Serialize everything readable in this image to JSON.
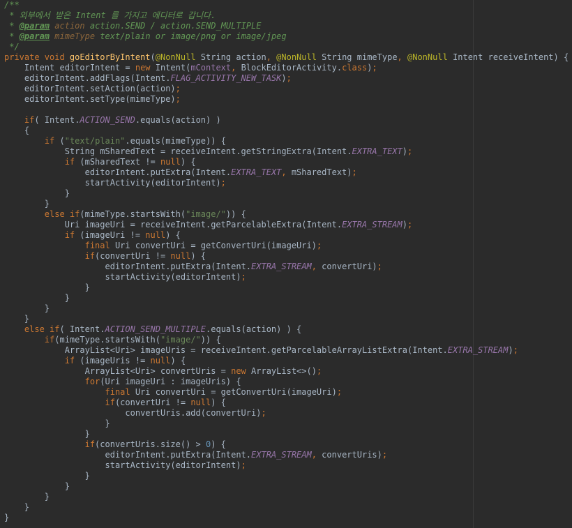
{
  "colors": {
    "background": "#2b2b2b",
    "text": "#a9b7c6",
    "keyword": "#cc7832",
    "string": "#6a8759",
    "number": "#6897bb",
    "annotation": "#bbb529",
    "method_declaration": "#ffc66d",
    "field": "#9876aa",
    "doc_comment": "#629755"
  },
  "lines": [
    [
      {
        "c": "cmt",
        "t": "/**"
      }
    ],
    [
      {
        "c": "cmt",
        "t": " * 외부에서 받은 Intent 를 가지고 에디터로 갑니다."
      }
    ],
    [
      {
        "c": "cmt",
        "t": " * "
      },
      {
        "c": "tag",
        "t": "@param"
      },
      {
        "c": "cmt",
        "t": " "
      },
      {
        "c": "tagv",
        "t": "action"
      },
      {
        "c": "cmt",
        "t": " action.SEND / action.SEND_MULTIPLE"
      }
    ],
    [
      {
        "c": "cmt",
        "t": " * "
      },
      {
        "c": "tag",
        "t": "@param"
      },
      {
        "c": "cmt",
        "t": " "
      },
      {
        "c": "tagv",
        "t": "mimeType"
      },
      {
        "c": "cmt",
        "t": " text/plain or image/png or image/jpeg"
      }
    ],
    [
      {
        "c": "cmt",
        "t": " */"
      }
    ],
    [
      {
        "c": "kw",
        "t": "private void "
      },
      {
        "c": "fn",
        "t": "goEditorByIntent"
      },
      {
        "c": "pl",
        "t": "("
      },
      {
        "c": "ann",
        "t": "@NonNull"
      },
      {
        "c": "pl",
        "t": " String action"
      },
      {
        "c": "kw",
        "t": ", "
      },
      {
        "c": "ann",
        "t": "@NonNull"
      },
      {
        "c": "pl",
        "t": " String mimeType"
      },
      {
        "c": "kw",
        "t": ", "
      },
      {
        "c": "ann",
        "t": "@NonNull"
      },
      {
        "c": "pl",
        "t": " Intent receiveIntent) {"
      }
    ],
    [
      {
        "c": "pl",
        "t": "    Intent editorIntent = "
      },
      {
        "c": "kw",
        "t": "new "
      },
      {
        "c": "pl",
        "t": "Intent("
      },
      {
        "c": "fld",
        "t": "mContext"
      },
      {
        "c": "kw",
        "t": ", "
      },
      {
        "c": "pl",
        "t": "BlockEditorActivity."
      },
      {
        "c": "kw",
        "t": "class"
      },
      {
        "c": "pl",
        "t": ")"
      },
      {
        "c": "kw",
        "t": ";"
      }
    ],
    [
      {
        "c": "pl",
        "t": "    editorIntent.addFlags(Intent."
      },
      {
        "c": "sfld",
        "t": "FLAG_ACTIVITY_NEW_TASK"
      },
      {
        "c": "pl",
        "t": ")"
      },
      {
        "c": "kw",
        "t": ";"
      }
    ],
    [
      {
        "c": "pl",
        "t": "    editorIntent.setAction(action)"
      },
      {
        "c": "kw",
        "t": ";"
      }
    ],
    [
      {
        "c": "pl",
        "t": "    editorIntent.setType(mimeType)"
      },
      {
        "c": "kw",
        "t": ";"
      }
    ],
    [
      {
        "c": "pl",
        "t": ""
      }
    ],
    [
      {
        "c": "kw",
        "t": "    if"
      },
      {
        "c": "pl",
        "t": "( Intent."
      },
      {
        "c": "sfld",
        "t": "ACTION_SEND"
      },
      {
        "c": "pl",
        "t": ".equals(action) )"
      }
    ],
    [
      {
        "c": "pl",
        "t": "    {"
      }
    ],
    [
      {
        "c": "kw",
        "t": "        if "
      },
      {
        "c": "pl",
        "t": "("
      },
      {
        "c": "str",
        "t": "\"text/plain\""
      },
      {
        "c": "pl",
        "t": ".equals(mimeType)) {"
      }
    ],
    [
      {
        "c": "pl",
        "t": "            String mSharedText = receiveIntent.getStringExtra(Intent."
      },
      {
        "c": "sfld",
        "t": "EXTRA_TEXT"
      },
      {
        "c": "pl",
        "t": ")"
      },
      {
        "c": "kw",
        "t": ";"
      }
    ],
    [
      {
        "c": "kw",
        "t": "            if "
      },
      {
        "c": "pl",
        "t": "(mSharedText != "
      },
      {
        "c": "kw",
        "t": "null"
      },
      {
        "c": "pl",
        "t": ") {"
      }
    ],
    [
      {
        "c": "pl",
        "t": "                editorIntent.putExtra(Intent."
      },
      {
        "c": "sfld",
        "t": "EXTRA_TEXT"
      },
      {
        "c": "kw",
        "t": ", "
      },
      {
        "c": "pl",
        "t": "mSharedText)"
      },
      {
        "c": "kw",
        "t": ";"
      }
    ],
    [
      {
        "c": "pl",
        "t": "                startActivity(editorIntent)"
      },
      {
        "c": "kw",
        "t": ";"
      }
    ],
    [
      {
        "c": "pl",
        "t": "            }"
      }
    ],
    [
      {
        "c": "pl",
        "t": "        }"
      }
    ],
    [
      {
        "c": "kw",
        "t": "        else if"
      },
      {
        "c": "pl",
        "t": "(mimeType.startsWith("
      },
      {
        "c": "str",
        "t": "\"image/\""
      },
      {
        "c": "pl",
        "t": ")) {"
      }
    ],
    [
      {
        "c": "pl",
        "t": "            Uri imageUri = receiveIntent.getParcelableExtra(Intent."
      },
      {
        "c": "sfld",
        "t": "EXTRA_STREAM"
      },
      {
        "c": "pl",
        "t": ")"
      },
      {
        "c": "kw",
        "t": ";"
      }
    ],
    [
      {
        "c": "kw",
        "t": "            if "
      },
      {
        "c": "pl",
        "t": "(imageUri != "
      },
      {
        "c": "kw",
        "t": "null"
      },
      {
        "c": "pl",
        "t": ") {"
      }
    ],
    [
      {
        "c": "kw",
        "t": "                final "
      },
      {
        "c": "pl",
        "t": "Uri convertUri = getConvertUri(imageUri)"
      },
      {
        "c": "kw",
        "t": ";"
      }
    ],
    [
      {
        "c": "kw",
        "t": "                if"
      },
      {
        "c": "pl",
        "t": "(convertUri != "
      },
      {
        "c": "kw",
        "t": "null"
      },
      {
        "c": "pl",
        "t": ") {"
      }
    ],
    [
      {
        "c": "pl",
        "t": "                    editorIntent.putExtra(Intent."
      },
      {
        "c": "sfld",
        "t": "EXTRA_STREAM"
      },
      {
        "c": "kw",
        "t": ", "
      },
      {
        "c": "pl",
        "t": "convertUri)"
      },
      {
        "c": "kw",
        "t": ";"
      }
    ],
    [
      {
        "c": "pl",
        "t": "                    startActivity(editorIntent)"
      },
      {
        "c": "kw",
        "t": ";"
      }
    ],
    [
      {
        "c": "pl",
        "t": "                }"
      }
    ],
    [
      {
        "c": "pl",
        "t": "            }"
      }
    ],
    [
      {
        "c": "pl",
        "t": "        }"
      }
    ],
    [
      {
        "c": "pl",
        "t": "    }"
      }
    ],
    [
      {
        "c": "kw",
        "t": "    else if"
      },
      {
        "c": "pl",
        "t": "( Intent."
      },
      {
        "c": "sfld",
        "t": "ACTION_SEND_MULTIPLE"
      },
      {
        "c": "pl",
        "t": ".equals(action) ) {"
      }
    ],
    [
      {
        "c": "kw",
        "t": "        if"
      },
      {
        "c": "pl",
        "t": "(mimeType.startsWith("
      },
      {
        "c": "str",
        "t": "\"image/\""
      },
      {
        "c": "pl",
        "t": ")) {"
      }
    ],
    [
      {
        "c": "pl",
        "t": "            ArrayList<Uri> imageUris = receiveIntent.getParcelableArrayListExtra(Intent."
      },
      {
        "c": "sfld",
        "t": "EXTRA_STREAM"
      },
      {
        "c": "pl",
        "t": ")"
      },
      {
        "c": "kw",
        "t": ";"
      }
    ],
    [
      {
        "c": "kw",
        "t": "            if "
      },
      {
        "c": "pl",
        "t": "(imageUris != "
      },
      {
        "c": "kw",
        "t": "null"
      },
      {
        "c": "pl",
        "t": ") {"
      }
    ],
    [
      {
        "c": "pl",
        "t": "                ArrayList<Uri> convertUris = "
      },
      {
        "c": "kw",
        "t": "new "
      },
      {
        "c": "pl",
        "t": "ArrayList<>()"
      },
      {
        "c": "kw",
        "t": ";"
      }
    ],
    [
      {
        "c": "kw",
        "t": "                for"
      },
      {
        "c": "pl",
        "t": "(Uri imageUri : imageUris) {"
      }
    ],
    [
      {
        "c": "kw",
        "t": "                    final "
      },
      {
        "c": "pl",
        "t": "Uri convertUri = getConvertUri(imageUri)"
      },
      {
        "c": "kw",
        "t": ";"
      }
    ],
    [
      {
        "c": "kw",
        "t": "                    if"
      },
      {
        "c": "pl",
        "t": "(convertUri != "
      },
      {
        "c": "kw",
        "t": "null"
      },
      {
        "c": "pl",
        "t": ") {"
      }
    ],
    [
      {
        "c": "pl",
        "t": "                        convertUris.add(convertUri)"
      },
      {
        "c": "kw",
        "t": ";"
      }
    ],
    [
      {
        "c": "pl",
        "t": "                    }"
      }
    ],
    [
      {
        "c": "pl",
        "t": "                }"
      }
    ],
    [
      {
        "c": "kw",
        "t": "                if"
      },
      {
        "c": "pl",
        "t": "(convertUris.size() > "
      },
      {
        "c": "num",
        "t": "0"
      },
      {
        "c": "pl",
        "t": ") {"
      }
    ],
    [
      {
        "c": "pl",
        "t": "                    editorIntent.putExtra(Intent."
      },
      {
        "c": "sfld",
        "t": "EXTRA_STREAM"
      },
      {
        "c": "kw",
        "t": ", "
      },
      {
        "c": "pl",
        "t": "convertUris)"
      },
      {
        "c": "kw",
        "t": ";"
      }
    ],
    [
      {
        "c": "pl",
        "t": "                    startActivity(editorIntent)"
      },
      {
        "c": "kw",
        "t": ";"
      }
    ],
    [
      {
        "c": "pl",
        "t": "                }"
      }
    ],
    [
      {
        "c": "pl",
        "t": "            }"
      }
    ],
    [
      {
        "c": "pl",
        "t": "        }"
      }
    ],
    [
      {
        "c": "pl",
        "t": "    }"
      }
    ],
    [
      {
        "c": "pl",
        "t": "}"
      }
    ]
  ]
}
